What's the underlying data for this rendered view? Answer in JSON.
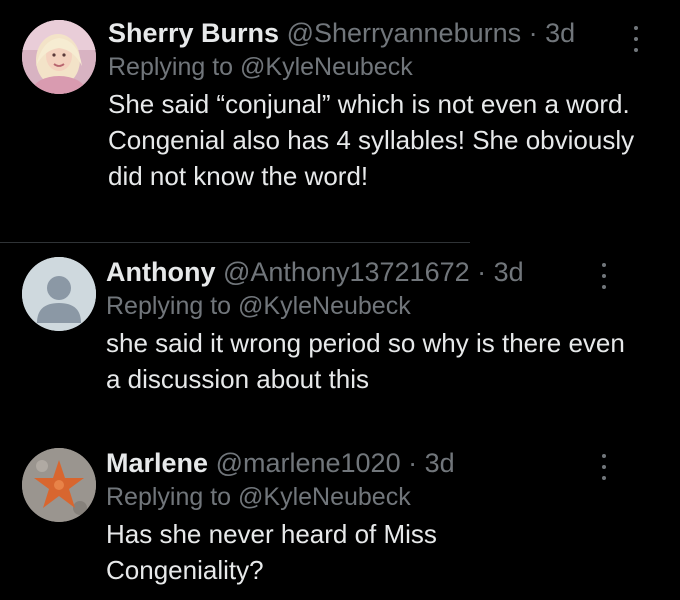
{
  "replies": [
    {
      "name": "Sherry Burns",
      "handle": "@Sherryanneburns",
      "separator": "·",
      "time": "3d",
      "replying_prefix": "Replying to",
      "replying_to": "@KyleNeubeck",
      "text": "She said “conjunal” which is not even a word. Congenial also has 4 syllables! She obviously did not know the word!",
      "avatar_icon": "user-photo"
    },
    {
      "name": "Anthony",
      "handle": "@Anthony13721672",
      "separator": "·",
      "time": "3d",
      "replying_prefix": "Replying to",
      "replying_to": "@KyleNeubeck",
      "text": "she said it wrong period so why is there even a discussion about this",
      "avatar_icon": "default-profile-icon"
    },
    {
      "name": "Marlene",
      "handle": "@marlene1020",
      "separator": "·",
      "time": "3d",
      "replying_prefix": "Replying to",
      "replying_to": "@KyleNeubeck",
      "text": "Has she never heard of Miss Congeniality?",
      "avatar_icon": "starfish-photo"
    }
  ],
  "colors": {
    "background": "#000000",
    "primary_text": "#e7e9ea",
    "secondary_text": "#71767b",
    "divider": "#2f3336"
  }
}
